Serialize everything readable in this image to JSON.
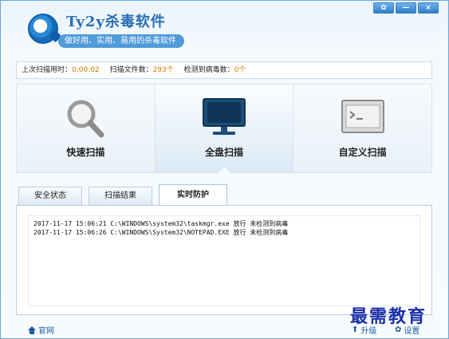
{
  "app": {
    "title": "Ty2y杀毒软件",
    "subtitle": "做好用、实用、易用的杀毒软件"
  },
  "window_controls": {
    "skin_icon": "gear-icon",
    "minimize": "—",
    "close": "×"
  },
  "stats": {
    "last_scan_label": "上次扫描用时：",
    "last_scan_value": "0:00:02",
    "files_label": "扫描文件数：",
    "files_value": "293个",
    "virus_label": "检测到病毒数：",
    "virus_value": "0个"
  },
  "scan_options": [
    {
      "label": "快速扫描",
      "icon": "magnifier-icon"
    },
    {
      "label": "全盘扫描",
      "icon": "monitor-icon"
    },
    {
      "label": "自定义扫描",
      "icon": "terminal-icon"
    }
  ],
  "active_scan": "全盘扫描",
  "tabs": [
    {
      "label": "安全状态"
    },
    {
      "label": "扫描结果"
    },
    {
      "label": "实时防护"
    }
  ],
  "active_tab": "实时防护",
  "log": [
    "2017-11-17 15:06:21 C:\\WINDOWS\\system32\\taskmgr.exe 放行 未检测到病毒",
    "2017-11-17 15:06:26 C:\\WINDOWS\\System32\\NOTEPAD.EXE 放行 未检测到病毒"
  ],
  "footer": {
    "website": "官网",
    "upgrade": "升级",
    "settings": "设置"
  },
  "watermark": "最需教育",
  "colors": {
    "accent": "#2a6eb4",
    "highlight_value": "#d07b00",
    "watermark": "#1c2fa8"
  }
}
